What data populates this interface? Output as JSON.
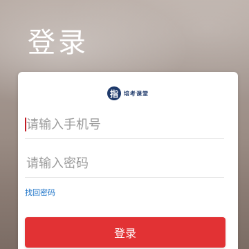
{
  "header": {
    "title": "登录"
  },
  "brand": {
    "badge": "指",
    "name": "培考课堂"
  },
  "form": {
    "phone_placeholder": "请输入手机号",
    "phone_value": "",
    "password_placeholder": "请输入密码",
    "password_value": "",
    "forgot_password_label": "找回密码",
    "login_label": "登录"
  },
  "colors": {
    "accent": "#e23234",
    "link": "#1e74c8",
    "brand": "#1f3a6b"
  }
}
